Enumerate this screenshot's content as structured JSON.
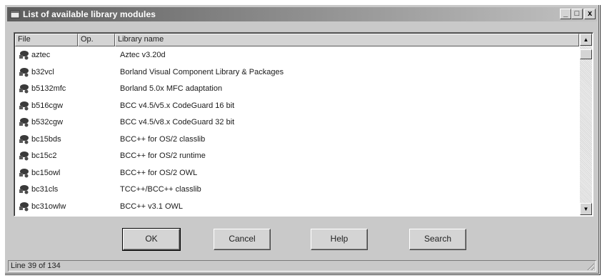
{
  "window": {
    "title": "List of available library modules",
    "minimize": "_",
    "maximize": "□",
    "close": "x"
  },
  "columns": [
    "File",
    "Op.",
    "Library name"
  ],
  "rows": [
    {
      "file": "aztec",
      "name": "Aztec v3.20d"
    },
    {
      "file": "b32vcl",
      "name": "Borland Visual Component Library & Packages"
    },
    {
      "file": "b5132mfc",
      "name": "Borland 5.0x MFC adaptation"
    },
    {
      "file": "b516cgw",
      "name": "BCC v4.5/v5.x CodeGuard 16 bit"
    },
    {
      "file": "b532cgw",
      "name": "BCC v4.5/v8.x CodeGuard 32 bit"
    },
    {
      "file": "bc15bds",
      "name": "BCC++ for OS/2 classlib"
    },
    {
      "file": "bc15c2",
      "name": "BCC++ for OS/2 runtime"
    },
    {
      "file": "bc15owl",
      "name": "BCC++ for OS/2 OWL"
    },
    {
      "file": "bc31cls",
      "name": "TCC++/BCC++ classlib"
    },
    {
      "file": "bc31owlw",
      "name": "BCC++ v3.1 OWL"
    }
  ],
  "buttons": {
    "ok": "OK",
    "cancel": "Cancel",
    "help": "Help",
    "search": "Search"
  },
  "status": "Line 39 of 134",
  "icons": {
    "title": "app-icon",
    "module": "module-icon",
    "scroll_up": "▲",
    "scroll_down": "▼"
  }
}
